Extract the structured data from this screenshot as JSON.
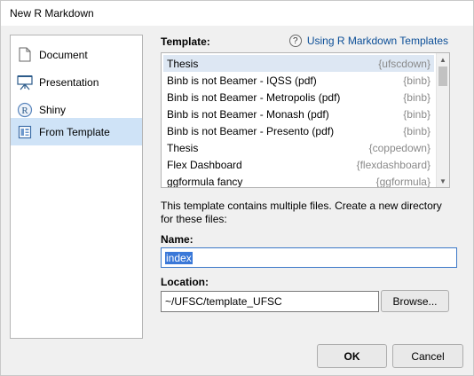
{
  "window": {
    "title": "New R Markdown"
  },
  "sidebar": {
    "items": [
      {
        "label": "Document",
        "icon": "document-icon",
        "selected": false
      },
      {
        "label": "Presentation",
        "icon": "presentation-icon",
        "selected": false
      },
      {
        "label": "Shiny",
        "icon": "shiny-r-icon",
        "selected": false
      },
      {
        "label": "From Template",
        "icon": "template-icon",
        "selected": true
      }
    ]
  },
  "template": {
    "label": "Template:",
    "help_link": "Using R Markdown Templates",
    "help_icon": "question-icon",
    "items": [
      {
        "name": "Thesis",
        "package": "{ufscdown}",
        "selected": true
      },
      {
        "name": "Binb is not Beamer - IQSS (pdf)",
        "package": "{binb}",
        "selected": false
      },
      {
        "name": "Binb is not Beamer - Metropolis (pdf)",
        "package": "{binb}",
        "selected": false
      },
      {
        "name": "Binb is not Beamer - Monash (pdf)",
        "package": "{binb}",
        "selected": false
      },
      {
        "name": "Binb is not Beamer - Presento (pdf)",
        "package": "{binb}",
        "selected": false
      },
      {
        "name": "Thesis",
        "package": "{coppedown}",
        "selected": false
      },
      {
        "name": "Flex Dashboard",
        "package": "{flexdashboard}",
        "selected": false
      },
      {
        "name": "ggformula fancy",
        "package": "{ggformula}",
        "selected": false
      }
    ]
  },
  "description": "This template contains multiple files. Create a new directory for these files:",
  "name_field": {
    "label": "Name:",
    "value": "index"
  },
  "location_field": {
    "label": "Location:",
    "value": "~/UFSC/template_UFSC",
    "browse_label": "Browse..."
  },
  "buttons": {
    "ok": "OK",
    "cancel": "Cancel"
  },
  "colors": {
    "selection": "#cfe3f7",
    "link": "#0b4e97",
    "text_selection": "#3a78d8"
  }
}
